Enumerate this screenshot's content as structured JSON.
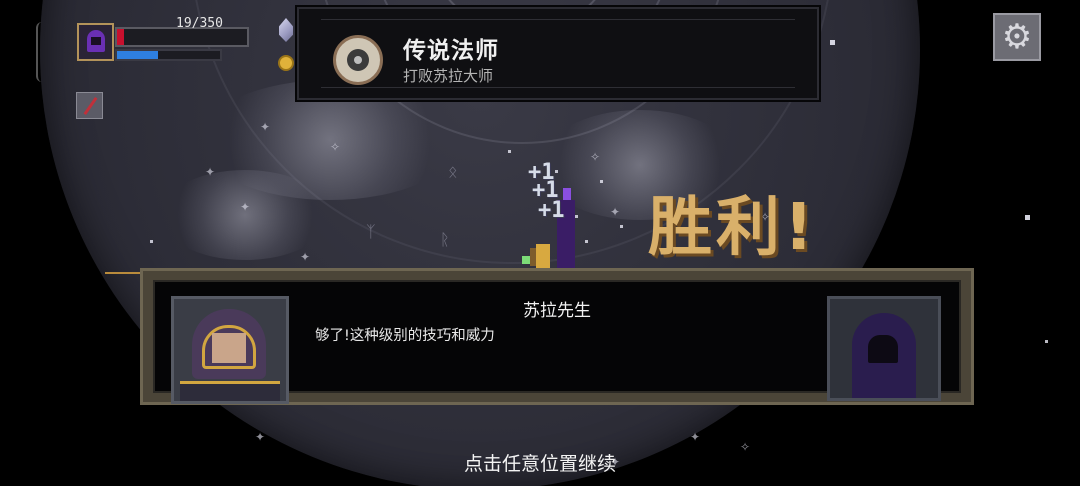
{
  "player": {
    "hp_text": "19/350",
    "hp_fraction": 0.054,
    "mana_fraction": 0.4,
    "portrait_icon": "hooded-mage-portrait-icon",
    "weapon_icon": "wand-icon"
  },
  "currency_icons": [
    "crystal-icon",
    "gold-coin-icon"
  ],
  "achievement": {
    "title": "传说法师",
    "subtitle": "打败苏拉大师",
    "badge_icon": "achievement-medal-icon"
  },
  "settings": {
    "icon": "gear-icon",
    "glyph": "⚙"
  },
  "combat": {
    "floating_texts": [
      "+1",
      "+1",
      "+1"
    ],
    "victory_text": "胜利!"
  },
  "dialog": {
    "speaker": "苏拉先生",
    "line": "够了!这种级别的技巧和威力"
  },
  "prompt": {
    "continue_text": "点击任意位置继续"
  },
  "colors": {
    "victory": "#d9b06a",
    "hp": "#c8102e",
    "mana": "#2e7fe0",
    "frame_gold": "#b3935a"
  }
}
